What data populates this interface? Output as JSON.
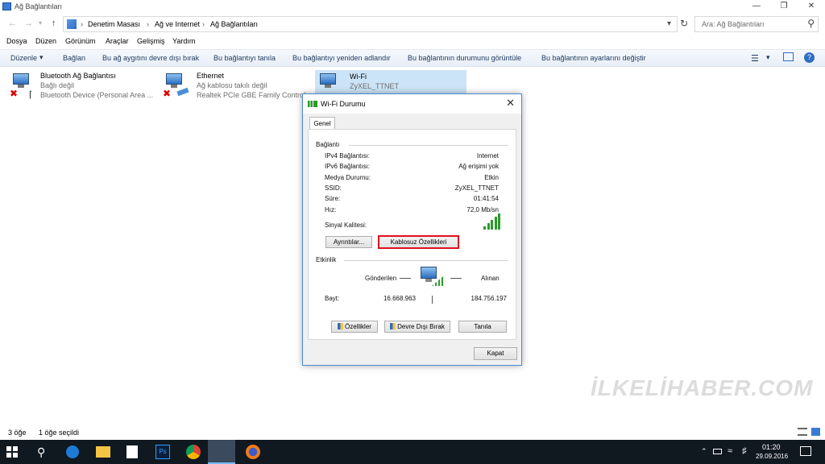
{
  "window": {
    "title": "Ağ Bağlantıları"
  },
  "address": {
    "crumbs": [
      "Denetim Masası",
      "Ağ ve Internet",
      "Ağ Bağlantıları"
    ],
    "search_placeholder": "Ara: Ağ Bağlantıları"
  },
  "menu": [
    "Dosya",
    "Düzen",
    "Görünüm",
    "Araçlar",
    "Gelişmiş",
    "Yardım"
  ],
  "commands": {
    "organize": "Düzenle",
    "items": [
      "Bağlan",
      "Bu ağ aygıtını devre dışı bırak",
      "Bu bağlantıyı tanıla",
      "Bu bağlantıyı yeniden adlandır",
      "Bu bağlantının durumunu görüntüle",
      "Bu bağlantının ayarlarını değiştir"
    ]
  },
  "connections": [
    {
      "name": "Bluetooth Ağ Bağlantısı",
      "status": "Bağlı değil",
      "device": "Bluetooth Device (Personal Area ..."
    },
    {
      "name": "Ethernet",
      "status": "Ağ kablosu takılı değil",
      "device": "Realtek PCIe GBE Family Controller"
    },
    {
      "name": "Wi-Fi",
      "status": "ZyXEL_TTNET",
      "device": ""
    }
  ],
  "dialog": {
    "title": "Wi-Fi Durumu",
    "tab": "Genel",
    "connection_group": "Bağlantı",
    "rows": [
      {
        "label": "IPv4 Bağlantısı:",
        "value": "Internet"
      },
      {
        "label": "IPv6 Bağlantısı:",
        "value": "Ağ erişimi yok"
      },
      {
        "label": "Medya Durumu:",
        "value": "Etkin"
      },
      {
        "label": "SSID:",
        "value": "ZyXEL_TTNET"
      },
      {
        "label": "Süre:",
        "value": "01:41:54"
      },
      {
        "label": "Hız:",
        "value": "72,0 Mb/sn"
      }
    ],
    "signal_label": "Sinyal Kalitesi:",
    "signal_bars_filled": 5,
    "details_button": "Ayrıntılar...",
    "wireless_button": "Kablosuz Özellikleri",
    "activity_group": "Etkinlik",
    "sent_label": "Gönderilen",
    "received_label": "Alınan",
    "bytes_label": "Bayt:",
    "bytes_sent": "16.668.963",
    "bytes_received": "184.756.197",
    "properties_button": "Özellikler",
    "disable_button": "Devre Dışı Bırak",
    "diagnose_button": "Tanıla",
    "close_button": "Kapat",
    "highlight_color": "#e01020"
  },
  "watermark": "İLKELİHABER.COM",
  "status": {
    "count": "3 öğe",
    "selected": "1 öğe seçildi"
  },
  "taskbar": {
    "time": "01:20",
    "date": "29.09.2016"
  }
}
